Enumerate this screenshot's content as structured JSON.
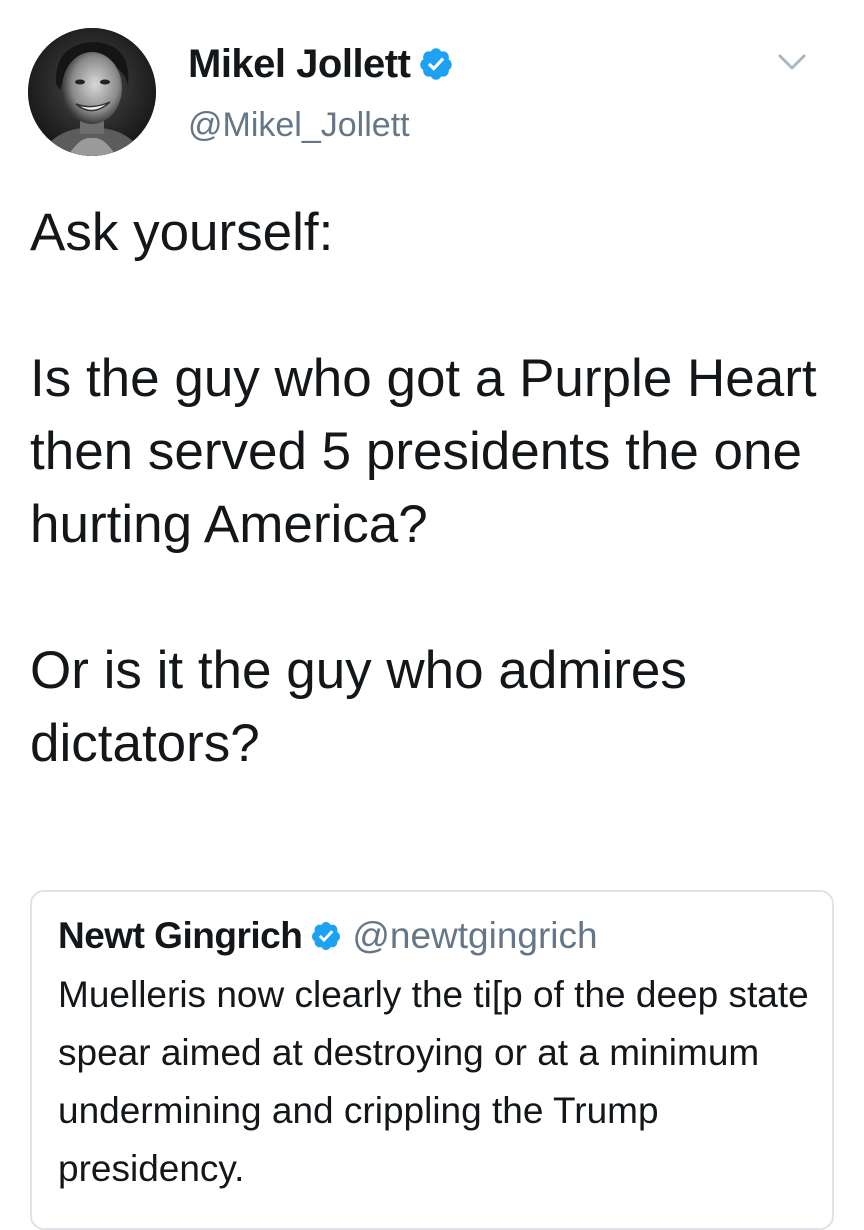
{
  "tweet": {
    "author": {
      "name": "Mikel Jollett",
      "handle": "@Mikel_Jollett",
      "verified": true
    },
    "text_paragraphs": [
      "Ask yourself:",
      "Is the guy who got a Purple Heart then served 5 presidents the one hurting America?",
      "Or is it the guy who admires dictators?"
    ],
    "quoted_tweet": {
      "author_name": "Newt Gingrich",
      "author_handle": "@newtgingrich",
      "verified": true,
      "text": "Muelleris now clearly the ti[p of the deep state spear aimed at destroying or at a minimum undermining and crippling the Trump presidency."
    }
  },
  "icons": {
    "verified": "verified-badge-icon",
    "menu": "chevron-down-icon"
  },
  "colors": {
    "verified_blue": "#1da1f2",
    "secondary_text": "#657786",
    "primary_text": "#14171a",
    "border": "#dfe3e7"
  }
}
